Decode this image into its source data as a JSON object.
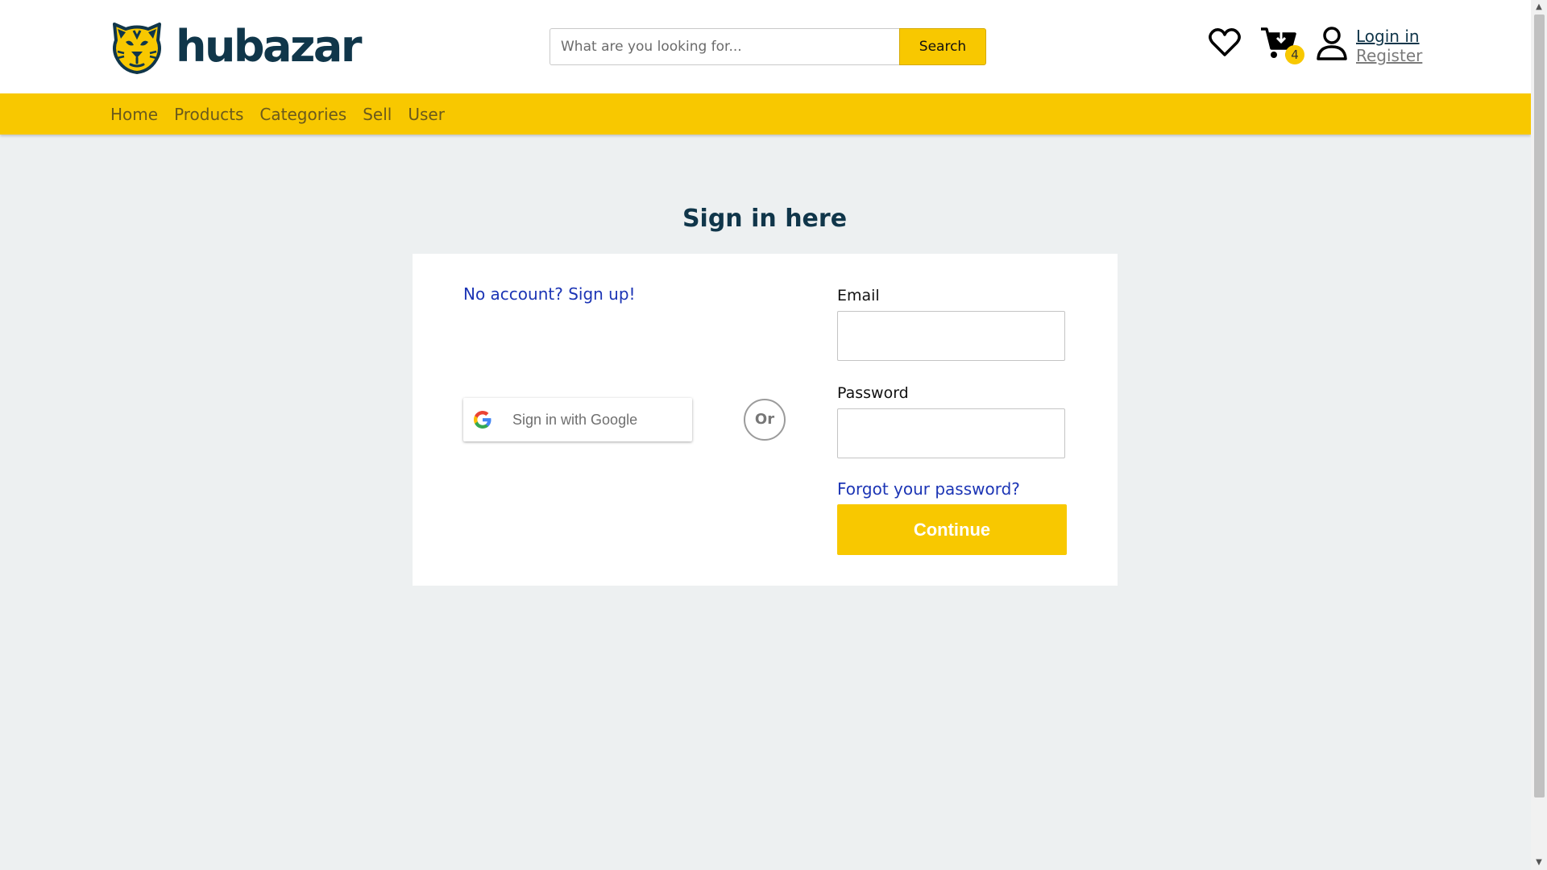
{
  "header": {
    "brand": "hubazar",
    "search": {
      "placeholder": "What are you looking for...",
      "value": "",
      "button_label": "Search"
    },
    "cart_count": "4",
    "login_label": "Login in",
    "register_label": "Register"
  },
  "nav": {
    "items": [
      {
        "label": "Home"
      },
      {
        "label": "Products"
      },
      {
        "label": "Categories"
      },
      {
        "label": "Sell"
      },
      {
        "label": "User"
      }
    ]
  },
  "main": {
    "title": "Sign in here",
    "signup_link": "No account? Sign up!",
    "google_button_label": "Sign in with Google",
    "or_label": "Or",
    "email_label": "Email",
    "password_label": "Password",
    "forgot_link": "Forgot your password?",
    "continue_label": "Continue"
  },
  "icons": {
    "logo": "tiger-face-logo-icon",
    "wishlist": "heart-icon",
    "cart": "cart-icon",
    "user": "user-icon",
    "google": "google-g-icon"
  },
  "colors": {
    "accent": "#f8c800",
    "brand_dark": "#10364a",
    "link": "#1c35b5",
    "background": "#edf0f1"
  }
}
